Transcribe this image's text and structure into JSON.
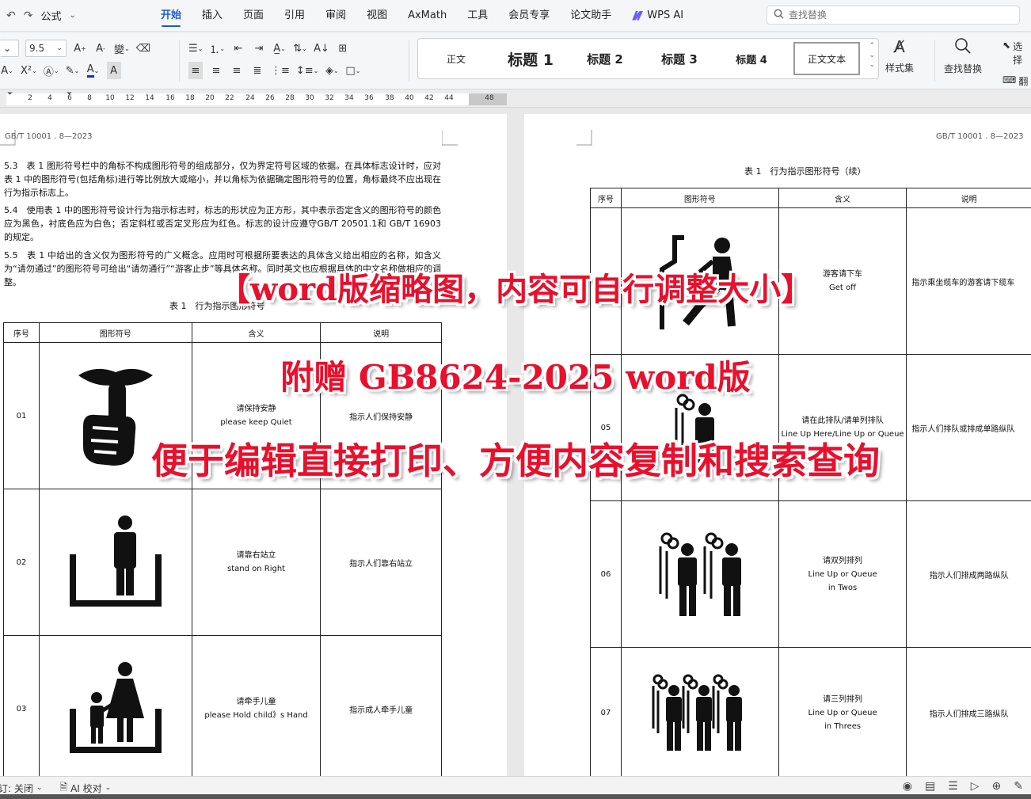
{
  "menubar": {
    "quick_access": {
      "undo_icon": "undo-icon",
      "redo_icon": "redo-icon",
      "formula_label": "公式"
    },
    "tabs": [
      "开始",
      "插入",
      "页面",
      "引用",
      "审阅",
      "视图",
      "AxMath",
      "工具",
      "会员专享",
      "论文助手"
    ],
    "active_tab": "开始",
    "wps_ai_label": "WPS AI",
    "search_placeholder": "查找替换"
  },
  "toolbar": {
    "font_size": "9.5",
    "styles": [
      "正文",
      "标题 1",
      "标题 2",
      "标题 3",
      "标题 4",
      "正文文本"
    ],
    "selected_style": "正文文本",
    "style_set_label": "样式集",
    "find_replace_label": "查找替换",
    "select_label": "选择",
    "translate_label": "翻译"
  },
  "ruler": {
    "ticks": [
      "2",
      "4",
      "6",
      "8",
      "10",
      "12",
      "14",
      "16",
      "18",
      "20",
      "22",
      "24",
      "26",
      "28",
      "30",
      "32",
      "34",
      "36",
      "38",
      "40",
      "42",
      "44",
      "48"
    ]
  },
  "left_page": {
    "header": "GB/T  10001 . 8—2023",
    "paragraphs": [
      "5.3　表 1 图形符号栏中的角标不构成图形符号的组成部分，仅为界定符号区域的依据。在具体标志设计时，应对表 1 中的图形符号(包括角标)进行等比例放大或缩小，并以角标为依据确定图形符号的位置，角标最终不应出现在行为指示标志上。",
      "5.4　使用表 1 中的图形符号设计行为指示标志时，标志的形状应为正方形，其中表示否定含义的图形符号的颜色应为黑色，衬底色应为白色；否定斜杠或否定叉形应为红色。标志的设计应遵守GB/T 20501.1和 GB/T 16903 的规定。",
      "5.5　表 1 中给出的含义仅为图形符号的广义概念。应用时可根据所要表达的具体含义给出相应的名称，如含义为“请勿通过”的图形符号可给出“请勿通行”“游客止步”等具体名称。同时英文也应根据具体的中文名称做相应的调整。"
    ],
    "table_caption": "表 1　行为指示图形符号",
    "table_headers": [
      "序号",
      "图形符号",
      "含义",
      "说明"
    ],
    "rows": [
      {
        "no": "01",
        "icon": "keep-quiet-icon",
        "meaning_cn": "请保持安静",
        "meaning_en": "please keep Quiet",
        "desc": "指示人们保持安静"
      },
      {
        "no": "02",
        "icon": "stand-on-right-icon",
        "meaning_cn": "请靠右站立",
        "meaning_en": "stand on Right",
        "desc": "指示人们靠右站立"
      },
      {
        "no": "03",
        "icon": "hold-child-hand-icon",
        "meaning_cn": "请牵手儿童",
        "meaning_en": "please Hold child》s Hand",
        "desc": "指示成人牵手儿童"
      }
    ]
  },
  "right_page": {
    "header": "GB/T  10001 . 8—2023",
    "table_caption": "表 1　行为指示图形符号（续）",
    "table_headers": [
      "序号",
      "图形符号",
      "含义",
      "说明"
    ],
    "rows": [
      {
        "no": "",
        "icon": "cable-car-get-off-icon",
        "meaning_cn": "游客请下车",
        "meaning_en": "Get off",
        "desc": "指示乘坐缆车的游客请下缆车"
      },
      {
        "no": "05",
        "icon": "line-up-here-icon",
        "meaning_cn": "请在此排队/请单列排队",
        "meaning_en": "Line Up Here/Line Up or Queue",
        "desc": "指示人们排队或排成单路纵队"
      },
      {
        "no": "06",
        "icon": "line-up-twos-icon",
        "meaning_cn": "请双列排列",
        "meaning_en": "Line Up or Queue",
        "meaning_en2": "in Twos",
        "desc": "指示人们排成两路纵队"
      },
      {
        "no": "07",
        "icon": "line-up-threes-icon",
        "meaning_cn": "请三列排列",
        "meaning_en": "Line Up or Queue",
        "meaning_en2": "in Threes",
        "desc": "指示人们排成三路纵队"
      }
    ]
  },
  "overlay": {
    "line1": "【word版缩略图，内容可自行调整大小】",
    "line2": "附赠 GB8624-2025 word版",
    "line3": "便于编辑直接打印、方便内容复制和搜索查询",
    "color": "#e8102c"
  },
  "statusbar": {
    "left_item": "修订: 关闭",
    "ai_check": "AI 校对"
  },
  "colors": {
    "accent": "#1a59d8"
  }
}
